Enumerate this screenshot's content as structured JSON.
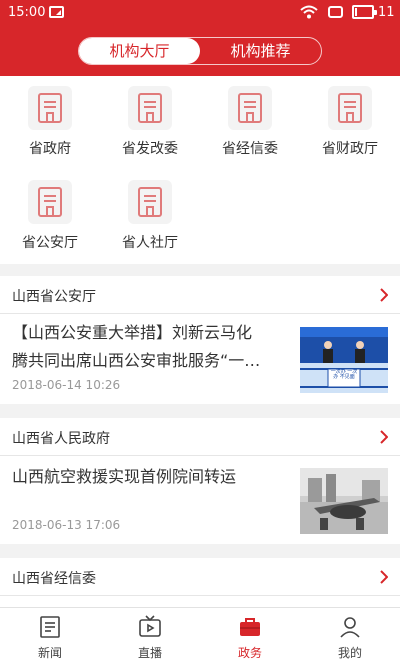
{
  "status_bar": {
    "time": "15:00",
    "battery": "11",
    "battery_level": 0.11
  },
  "tabs": [
    {
      "label": "机构大厅",
      "active": true
    },
    {
      "label": "机构推荐",
      "active": false
    }
  ],
  "departments": [
    {
      "label": "省政府",
      "icon": "government-building-icon"
    },
    {
      "label": "省发改委",
      "icon": "government-building-icon"
    },
    {
      "label": "省经信委",
      "icon": "government-building-icon"
    },
    {
      "label": "省财政厅",
      "icon": "government-building-icon"
    },
    {
      "label": "省公安厅",
      "icon": "government-building-icon"
    },
    {
      "label": "省人社厅",
      "icon": "government-building-icon"
    }
  ],
  "sections": [
    {
      "title": "山西省公安厅",
      "article": {
        "title_line1": "【山西公安重大举措】刘新云马化",
        "title_line2": "腾共同出席山西公安审批服务“一…",
        "date": "2018-06-14 10:26",
        "thumb_text": "一次办 一次办 不见面"
      }
    },
    {
      "title": "山西省人民政府",
      "article": {
        "title_line1": "山西航空救援实现首例院间转运",
        "date": "2018-06-13 17:06"
      }
    },
    {
      "title": "山西省经信委"
    }
  ],
  "bottom_nav": [
    {
      "label": "新闻",
      "icon": "news-icon",
      "active": false
    },
    {
      "label": "直播",
      "icon": "live-tv-icon",
      "active": false
    },
    {
      "label": "政务",
      "icon": "briefcase-icon",
      "active": true
    },
    {
      "label": "我的",
      "icon": "user-icon",
      "active": false
    }
  ],
  "colors": {
    "brand_red": "#d7262a",
    "icon_pink": "#e07a7a",
    "text": "#333333",
    "muted": "#999999"
  }
}
